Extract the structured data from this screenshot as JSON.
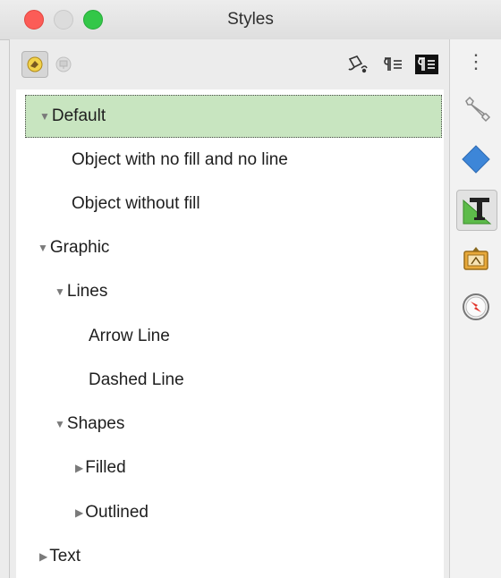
{
  "window": {
    "title": "Styles"
  },
  "colors": {
    "selected_bg": "#c8e5c0",
    "close": "#fc5c57",
    "maximize": "#33c748"
  },
  "toolbar": {
    "left_buttons": [
      {
        "icon": "drawing-styles-icon",
        "pressed": true
      },
      {
        "icon": "presentation-styles-icon",
        "pressed": false
      }
    ],
    "right_buttons": [
      {
        "icon": "fill-format-mode-icon"
      },
      {
        "icon": "new-style-from-selection-icon"
      },
      {
        "icon": "update-style-icon"
      }
    ]
  },
  "styles_tree": [
    {
      "label": "Default",
      "expanded": true,
      "selected": true
    },
    {
      "label": "Object with no fill and no line"
    },
    {
      "label": "Object without fill"
    },
    {
      "label": "Graphic",
      "expanded": true
    },
    {
      "label": "Lines",
      "expanded": true
    },
    {
      "label": "Arrow Line"
    },
    {
      "label": "Dashed Line"
    },
    {
      "label": "Shapes",
      "expanded": true
    },
    {
      "label": "Filled",
      "expanded": false
    },
    {
      "label": "Outlined",
      "expanded": false
    },
    {
      "label": "Text",
      "expanded": false
    }
  ],
  "sidebar": {
    "menu_glyph": "⋮",
    "items": [
      {
        "icon": "properties-wrench-icon"
      },
      {
        "icon": "shapes-diamond-icon"
      },
      {
        "icon": "styles-icon",
        "active": true
      },
      {
        "icon": "gallery-icon"
      },
      {
        "icon": "navigator-compass-icon"
      }
    ]
  }
}
